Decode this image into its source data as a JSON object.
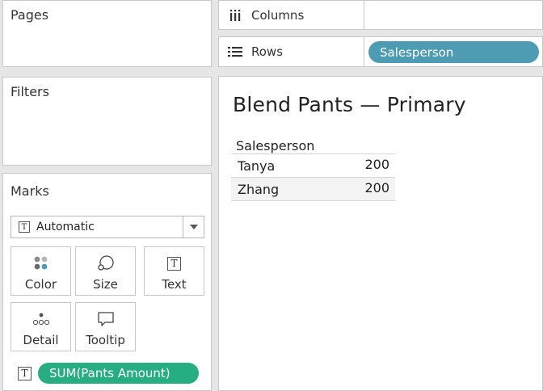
{
  "pages": {
    "title": "Pages"
  },
  "filters": {
    "title": "Filters"
  },
  "shelves": {
    "columns": {
      "label": "Columns",
      "icon": "columns-icon"
    },
    "rows": {
      "label": "Rows",
      "icon": "rows-icon",
      "pill": "Salesperson",
      "pill_color": "#4e9cb4"
    }
  },
  "marks": {
    "title": "Marks",
    "mark_type": "Automatic",
    "buttons": {
      "color": "Color",
      "size": "Size",
      "text": "Text",
      "detail": "Detail",
      "tooltip": "Tooltip"
    },
    "field_pill": "SUM(Pants Amount)",
    "field_pill_color": "#26ad82"
  },
  "view": {
    "title": "Blend Pants — Primary",
    "header": "Salesperson",
    "rows": [
      {
        "name": "Tanya",
        "value": "200"
      },
      {
        "name": "Zhang",
        "value": "200"
      }
    ]
  }
}
